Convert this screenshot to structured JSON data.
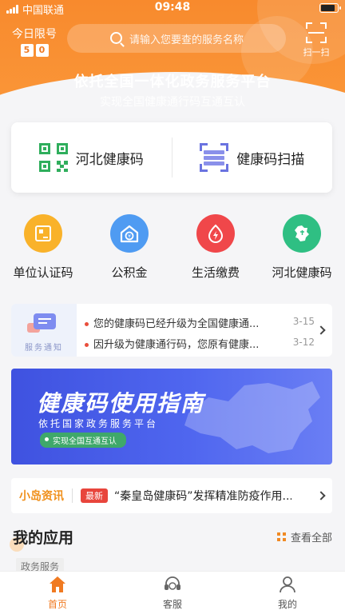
{
  "status_bar": {
    "carrier": "中国联通",
    "time": "09:48"
  },
  "header": {
    "limit_label": "今日限号",
    "limit_digits": [
      "5",
      "0"
    ],
    "search_placeholder": "请输入您要查的服务名称",
    "scan_label": "扫一扫",
    "slogan_main": "依托全国一体化政务服务平台",
    "slogan_sub": "实现全国健康通行码互通互认"
  },
  "health_card": {
    "left_label": "河北健康码",
    "right_label": "健康码扫描"
  },
  "services": [
    {
      "label": "单位认证码",
      "color": "#f9b22a",
      "icon": "id-code-icon"
    },
    {
      "label": "公积金",
      "color": "#4f9bf2",
      "icon": "housing-fund-icon"
    },
    {
      "label": "生活缴费",
      "color": "#f0474a",
      "icon": "utility-payment-icon"
    },
    {
      "label": "河北健康码",
      "color": "#2fbf83",
      "icon": "hebei-map-icon"
    }
  ],
  "notice": {
    "title": "服务通知",
    "items": [
      {
        "text": "您的健康码已经升级为全国健康通...",
        "date": "3-15"
      },
      {
        "text": "因升级为健康通行码，您原有健康...",
        "date": "3-12"
      }
    ]
  },
  "banner": {
    "title": "健康码使用指南",
    "subtitle": "依托国家政务服务平台",
    "pill": "实现全国互通互认"
  },
  "news": {
    "brand": "小岛资讯",
    "badge": "最新",
    "text": "“秦皇岛健康码”发挥精准防疫作用..."
  },
  "apps": {
    "title": "我的应用",
    "view_all": "查看全部",
    "chip": "政务服务"
  },
  "tabs": [
    {
      "label": "首页",
      "active": true
    },
    {
      "label": "客服",
      "active": false
    },
    {
      "label": "我的",
      "active": false
    }
  ],
  "colors": {
    "accent": "#f07a21",
    "header": "#f88a2d",
    "banner": "#4a5ee8"
  }
}
